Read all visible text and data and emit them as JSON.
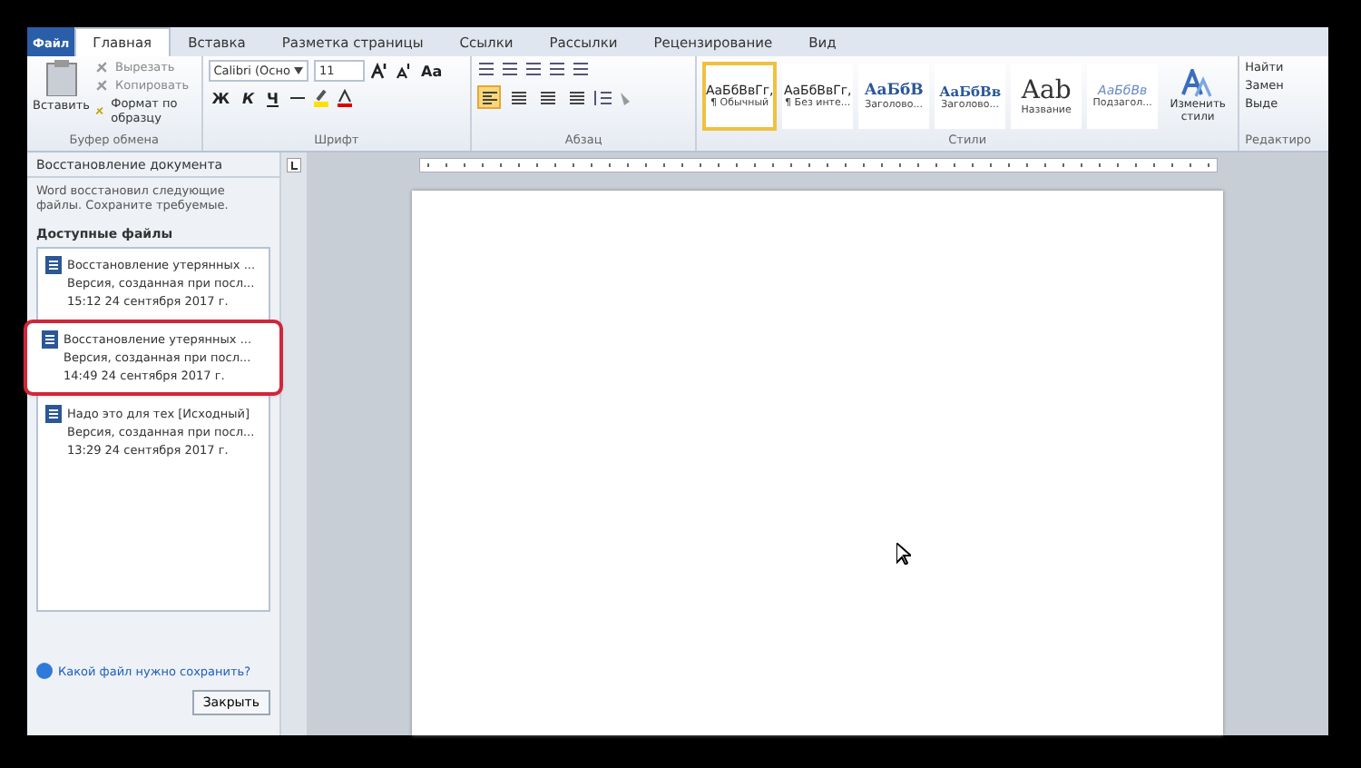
{
  "tabs": [
    {
      "label": "Файл",
      "kind": "file",
      "selected": false
    },
    {
      "label": "Главная",
      "kind": "tab",
      "selected": true
    },
    {
      "label": "Вставка",
      "kind": "tab",
      "selected": false
    },
    {
      "label": "Разметка страницы",
      "kind": "tab",
      "selected": false
    },
    {
      "label": "Ссылки",
      "kind": "tab",
      "selected": false
    },
    {
      "label": "Рассылки",
      "kind": "tab",
      "selected": false
    },
    {
      "label": "Рецензирование",
      "kind": "tab",
      "selected": false
    },
    {
      "label": "Вид",
      "kind": "tab",
      "selected": false
    }
  ],
  "clipboard": {
    "paste": "Вставить",
    "items": [
      "Вырезать",
      "Копировать",
      "Формат по образцу"
    ],
    "label": "Буфер обмена"
  },
  "font": {
    "family": "Calibri (Осно",
    "size": "11",
    "case_button": "Aa",
    "format_keys": [
      "Ж",
      "К",
      "Ч"
    ],
    "label": "Шрифт"
  },
  "paragraph": {
    "label": "Абзац",
    "align": [
      {
        "selected": true
      },
      {
        "selected": false
      },
      {
        "selected": false
      },
      {
        "selected": false
      }
    ]
  },
  "styles": {
    "label": "Стили",
    "items": [
      {
        "sample": "АаБбВвГг,",
        "name": "¶ Обычный",
        "kind": "normal",
        "selected": true
      },
      {
        "sample": "АаБбВвГг,",
        "name": "¶ Без инте...",
        "kind": "normal",
        "selected": false
      },
      {
        "sample": "АаБбВ",
        "name": "Заголово...",
        "kind": "heading",
        "selected": false
      },
      {
        "sample": "АаБбВв",
        "name": "Заголово...",
        "kind": "heading2",
        "selected": false
      },
      {
        "sample": "Aab",
        "name": "Название",
        "kind": "title",
        "selected": false
      },
      {
        "sample": "АаБбВв",
        "name": "Подзагол...",
        "kind": "subtitle",
        "selected": false
      }
    ]
  },
  "change_styles": "Изменить стили",
  "editing": {
    "label": "Редактиро",
    "items": [
      "Найти",
      "Замен",
      "Выде"
    ]
  },
  "recovery_pane": {
    "title": "Восстановление документа",
    "message": "Word восстановил следующие файлы. Сохраните требуемые.",
    "section": "Доступные файлы",
    "files": [
      {
        "title": "Восстановление утерянных ...",
        "subtitle": "Версия, созданная при посл...",
        "time": "15:12 24 сентября 2017 г.",
        "highlighted": false
      },
      {
        "title": "Восстановление утерянных ...",
        "subtitle": "Версия, созданная при посл...",
        "time": "14:49 24 сентября 2017 г.",
        "highlighted": true
      },
      {
        "title": "Надо это для тех [Исходный]",
        "subtitle": "Версия, созданная при посл...",
        "time": "13:29 24 сентября 2017 г.",
        "highlighted": false
      }
    ],
    "help_link": "Какой файл нужно сохранить?",
    "close_button": "Закрыть"
  }
}
